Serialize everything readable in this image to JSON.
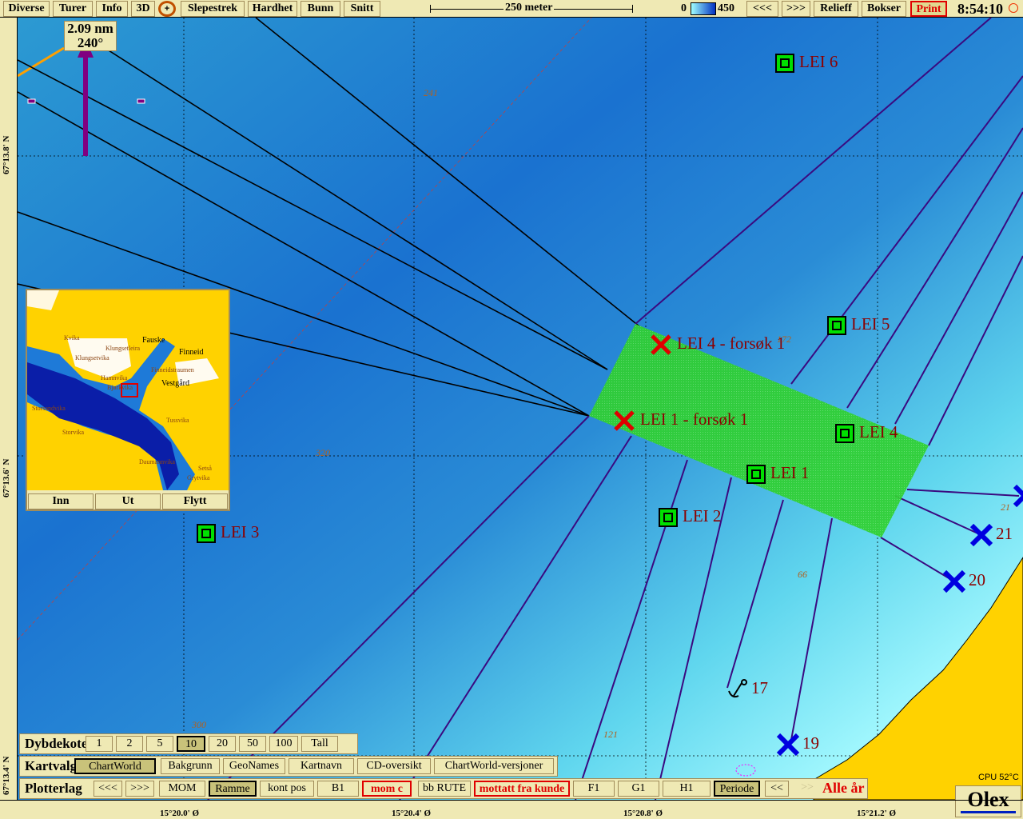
{
  "toolbar": {
    "items": [
      "Diverse",
      "Turer",
      "Info",
      "3D",
      "Slepestrek",
      "Hardhet",
      "Bunn",
      "Snitt"
    ],
    "scale_label": "250 meter",
    "depth_min": "0",
    "depth_max": "450",
    "prev": "<<<",
    "next": ">>>",
    "relieff": "Relieff",
    "bokser": "Bokser",
    "print": "Print",
    "time": "8:54:10"
  },
  "colors": {
    "accent_red": "#e00000",
    "land": "#ffd200",
    "waypoint_green": "#00e000",
    "marker_blue": "#0000e0",
    "label": "#8b0000"
  },
  "bearing": {
    "distance": "2.09 nm",
    "heading": "240°"
  },
  "lat_labels": [
    "67°13.8' N",
    "67°13.6' N",
    "67°13.4' N"
  ],
  "lon_labels": [
    "15°20.0' Ø",
    "15°20.4' Ø",
    "15°20.8' Ø",
    "15°21.2' Ø"
  ],
  "depths": [
    "241",
    "320",
    "300",
    "121",
    "66",
    "21",
    "172"
  ],
  "waypoints": [
    "LEI 6",
    "LEI 5",
    "LEI 4",
    "LEI 1",
    "LEI 2",
    "LEI 3"
  ],
  "attempts": [
    "LEI 4 - forsøk 1",
    "LEI 1 - forsøk 1"
  ],
  "marks": [
    "21",
    "20",
    "19",
    "17"
  ],
  "minimap": {
    "names": [
      "Fauske",
      "Finneid",
      "Vestgård",
      "Klungsetvika",
      "Klungsetleira",
      "Kvika",
      "Hamnvika",
      "Bjørkvika",
      "Finneidstraumen",
      "Storsandvika",
      "Storvika",
      "Tussvika",
      "Grytvika",
      "Daumannvika",
      "Setså"
    ],
    "buttons": [
      "Inn",
      "Ut",
      "Flytt"
    ]
  },
  "dybdekoter": {
    "title": "Dybdekoter",
    "options": [
      "1",
      "2",
      "5",
      "10",
      "20",
      "50",
      "100",
      "Tall"
    ],
    "selected": "10"
  },
  "kartvalg": {
    "title": "Kartvalg",
    "options": [
      "ChartWorld",
      "Bakgrunn",
      "GeoNames",
      "Kartnavn",
      "CD-oversikt",
      "ChartWorld-versjoner"
    ],
    "selected": "ChartWorld"
  },
  "plotterlag": {
    "title": "Plotterlag",
    "options": [
      "<<<",
      ">>>",
      "MOM",
      "Ramme",
      "kont pos",
      "B1",
      "mom c",
      "bb RUTE",
      "mottatt fra kunde",
      "F1",
      "G1",
      "H1",
      "Periode",
      "<<",
      ">>"
    ],
    "selected": [
      "Ramme",
      "Periode"
    ],
    "year": "Alle år"
  },
  "status": {
    "cpu": "CPU 52°C",
    "brand": "Olex"
  }
}
